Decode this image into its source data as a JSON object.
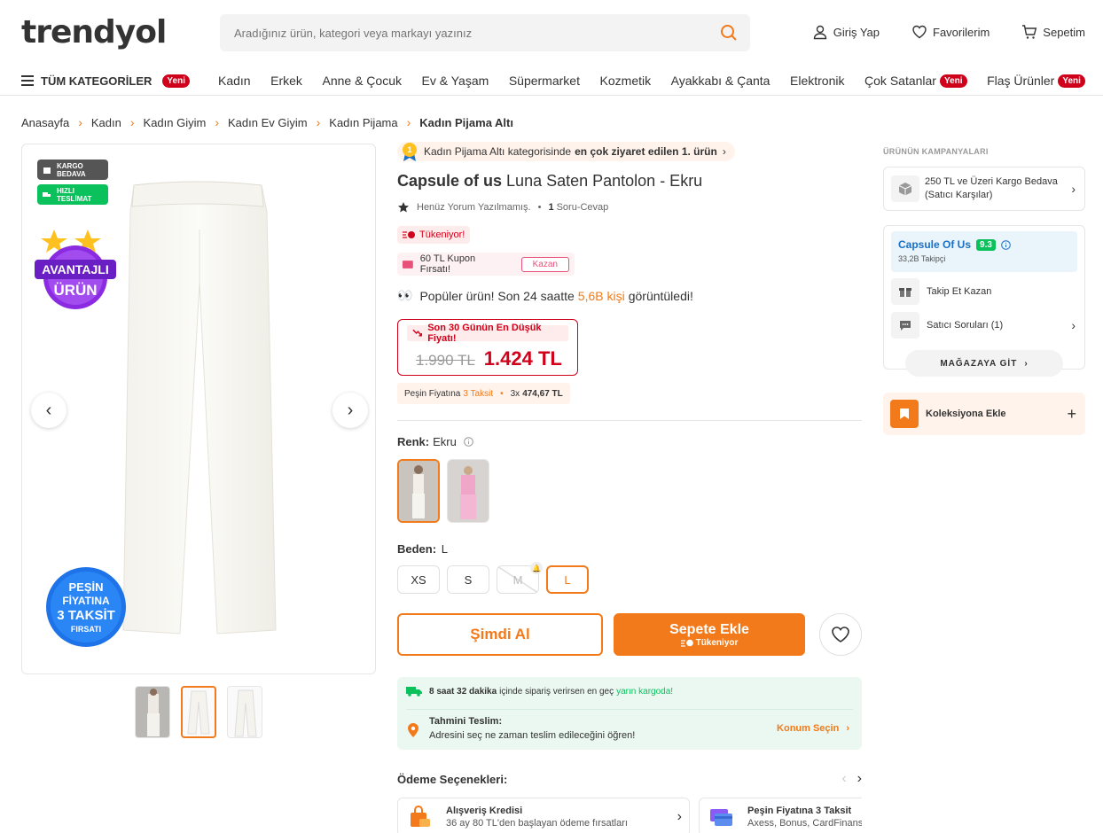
{
  "header": {
    "logo": "trendyol",
    "search_placeholder": "Aradığınız ürün, kategori veya markayı yazınız",
    "login": "Giriş Yap",
    "favorites": "Favorilerim",
    "cart": "Sepetim"
  },
  "nav": {
    "all_categories": "TÜM KATEGORİLER",
    "new_badge": "Yeni",
    "items": [
      "Kadın",
      "Erkek",
      "Anne & Çocuk",
      "Ev & Yaşam",
      "Süpermarket",
      "Kozmetik",
      "Ayakkabı & Çanta",
      "Elektronik",
      "Çok Satanlar",
      "Flaş Ürünler"
    ]
  },
  "breadcrumb": [
    "Anasayfa",
    "Kadın",
    "Kadın Giyim",
    "Kadın Ev Giyim",
    "Kadın Pijama",
    "Kadın Pijama Altı"
  ],
  "gallery": {
    "tag_cargo": "KARGO BEDAVA",
    "tag_fast": "HIZLI TESLİMAT",
    "adv_line1": "AVANTAJLI",
    "adv_line2": "ÜRÜN",
    "pesin_line1": "PEŞİN",
    "pesin_line2": "FİYATINA",
    "pesin_line3": "3 TAKSİT",
    "pesin_line4": "FIRSATI"
  },
  "product": {
    "best_prefix": "Kadın Pijama Altı kategorisinde",
    "best_bold": "en çok ziyaret edilen 1. ürün",
    "best_rank": "1",
    "brand": "Capsule of us",
    "name": "Luna Saten Pantolon - Ekru",
    "no_review": "Henüz Yorum Yazılmamış.",
    "qa_count": "1",
    "qa_label": "Soru-Cevap",
    "tukeniyor": "Tükeniyor!",
    "coupon": "60 TL Kupon Fırsatı!",
    "coupon_btn": "Kazan",
    "popular_pre": "Popüler ürün! Son 24 saatte",
    "popular_hl": "5,6B kişi",
    "popular_post": "görüntüledi!",
    "low_price_label": "Son 30 Günün En Düşük Fiyatı!",
    "old_price": "1.990 TL",
    "new_price": "1.424 TL",
    "taksit_pre": "Peşin Fiyatına",
    "taksit_hl": "3 Taksit",
    "taksit_count": "3x",
    "taksit_amount": "474,67 TL",
    "color_label": "Renk:",
    "color_value": "Ekru",
    "size_label": "Beden:",
    "size_value": "L",
    "sizes": [
      "XS",
      "S",
      "M",
      "L"
    ],
    "buy_now": "Şimdi Al",
    "add_cart": "Sepete Ekle",
    "add_cart_sub": "Tükeniyor"
  },
  "delivery": {
    "time": "8 saat 32 dakika",
    "time_post": "içinde sipariş verirsen en geç",
    "time_hl": "yarın kargoda!",
    "est_title": "Tahmini Teslim:",
    "est_sub": "Adresini seç ne zaman teslim edileceğini öğren!",
    "location_btn": "Konum Seçin"
  },
  "payment": {
    "title": "Ödeme Seçenekleri:",
    "cards": [
      {
        "title": "Alışveriş Kredisi",
        "sub": "36 ay 80 TL'den başlayan ödeme fırsatları"
      },
      {
        "title": "Peşin Fiyatına 3 Taksit",
        "sub": "Axess, Bonus, CardFinans, Maximum, World"
      }
    ]
  },
  "side": {
    "campaigns_title": "ÜRÜNÜN KAMPANYALARI",
    "campaign_text": "250 TL ve Üzeri Kargo Bedava (Satıcı Karşılar)",
    "seller_name": "Capsule Of Us",
    "seller_score": "9.3",
    "followers": "33,2B Takipçi",
    "follow_win": "Takip Et Kazan",
    "seller_questions": "Satıcı Soruları (1)",
    "store_btn": "MAĞAZAYA GİT",
    "collection": "Koleksiyona Ekle"
  },
  "colors": {
    "accent": "#f27a1a",
    "discount_red": "#d0021b",
    "green": "#0bc15c"
  }
}
